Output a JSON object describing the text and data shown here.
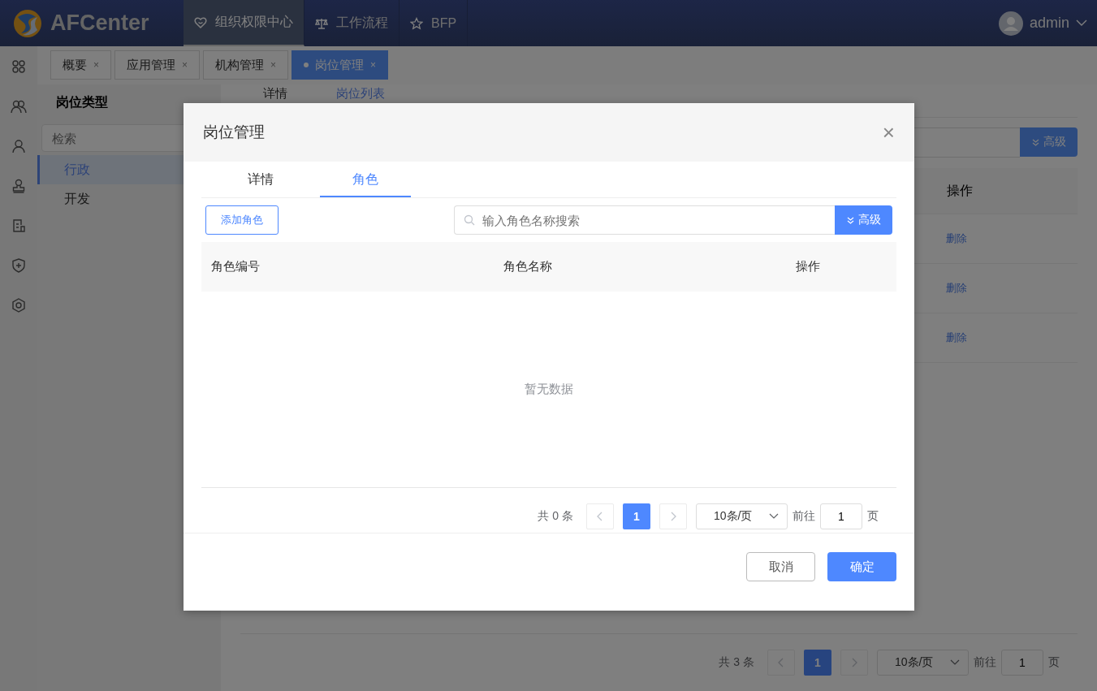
{
  "header": {
    "logo": "AFCenter",
    "nav": [
      {
        "label": "组织权限中心",
        "kind": "heart",
        "selected": true
      },
      {
        "label": "工作流程",
        "kind": "scale",
        "selected": false
      },
      {
        "label": "BFP",
        "kind": "star",
        "selected": false
      }
    ],
    "user": "admin"
  },
  "page_tabs": [
    {
      "label": "概要",
      "close": "×",
      "selected": false
    },
    {
      "label": "应用管理",
      "close": "×",
      "selected": false
    },
    {
      "label": "机构管理",
      "close": "×",
      "selected": false
    },
    {
      "label": "岗位管理",
      "close": "×",
      "selected": true
    }
  ],
  "left_panel": {
    "title": "岗位类型",
    "search": {
      "placeholder": "检索"
    },
    "items": [
      {
        "label": "行政",
        "selected": true
      },
      {
        "label": "开发",
        "selected": false
      }
    ]
  },
  "main": {
    "tabs": [
      {
        "label": "详情",
        "selected": false
      },
      {
        "label": "岗位列表",
        "selected": true
      }
    ],
    "advanced_button": "高级",
    "column": "操作",
    "rows": [
      "删除",
      "删除",
      "删除"
    ],
    "pagination": {
      "total": "共 3 条",
      "page": "1",
      "page_size": "10条/页",
      "goto": "前往",
      "goto_value": "1",
      "unit": "页"
    }
  },
  "dialog": {
    "title": "岗位管理",
    "close": "×",
    "tabs": [
      {
        "label": "详情",
        "selected": false
      },
      {
        "label": "角色",
        "selected": true
      }
    ],
    "add_button": "添加角色",
    "search": {
      "placeholder": "输入角色名称搜索"
    },
    "advanced_button": "高级",
    "columns": [
      "角色编号",
      "角色名称",
      "操作"
    ],
    "empty": "暂无数据",
    "pagination": {
      "total": "共 0 条",
      "page": "1",
      "page_size": "10条/页",
      "goto": "前往",
      "goto_value": "1",
      "unit": "页"
    },
    "cancel": "取消",
    "confirm": "确定"
  }
}
